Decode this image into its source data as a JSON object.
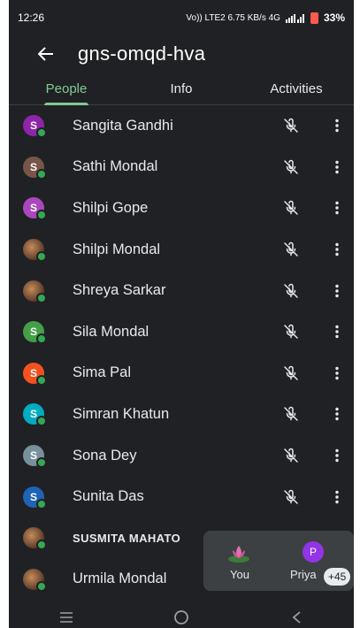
{
  "status_bar": {
    "time": "12:26",
    "network_text": "Vo)) LTE2  6.75 KB/s  4G",
    "battery_percent": "33%"
  },
  "header": {
    "back_icon": "arrow-left-icon",
    "title": "gns-omqd-hva"
  },
  "tabs": [
    {
      "label": "People",
      "active": true
    },
    {
      "label": "Info",
      "active": false
    },
    {
      "label": "Activities",
      "active": false
    }
  ],
  "colors": {
    "accent": "#81c995",
    "background": "#202124",
    "online": "#34a853"
  },
  "people": [
    {
      "name": "Sangita Gandhi",
      "initial": "S",
      "avatar_color": "#8e24aa",
      "photo": false
    },
    {
      "name": "Sathi Mondal",
      "initial": "S",
      "avatar_color": "#795548",
      "photo": false
    },
    {
      "name": "Shilpi Gope",
      "initial": "S",
      "avatar_color": "#ab47bc",
      "photo": false
    },
    {
      "name": "Shilpi Mondal",
      "initial": "",
      "avatar_color": "#a1522c",
      "photo": true
    },
    {
      "name": "Shreya Sarkar",
      "initial": "",
      "avatar_color": "#6d5d52",
      "photo": true
    },
    {
      "name": "Sila Mondal",
      "initial": "S",
      "avatar_color": "#43a047",
      "photo": false
    },
    {
      "name": "Sima Pal",
      "initial": "S",
      "avatar_color": "#f4511e",
      "photo": false
    },
    {
      "name": "Simran Khatun",
      "initial": "S",
      "avatar_color": "#00acc1",
      "photo": false
    },
    {
      "name": "Sona Dey",
      "initial": "S",
      "avatar_color": "#78909c",
      "photo": false
    },
    {
      "name": "Sunita Das",
      "initial": "S",
      "avatar_color": "#1e63b5",
      "photo": false
    },
    {
      "name": "SUSMITA MAHATO",
      "initial": "",
      "avatar_color": "#8a9aa6",
      "photo": true
    },
    {
      "name": "Urmila Mondal",
      "initial": "",
      "avatar_color": "#7a8a7a",
      "photo": true
    }
  ],
  "self_card": {
    "you_label": "You",
    "other_initial": "P",
    "other_label": "Priya",
    "more_count": "+45"
  },
  "nav": {
    "recents_icon": "recents-icon",
    "home_icon": "home-icon",
    "back_icon": "nav-back-icon"
  }
}
